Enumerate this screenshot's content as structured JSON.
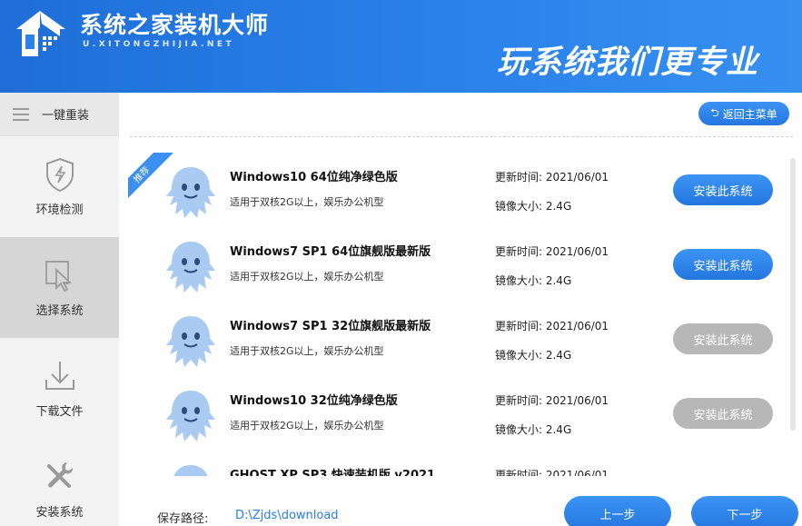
{
  "header": {
    "brand_title": "系统之家装机大师",
    "brand_sub": "U.XITONGZHIJIA.NET",
    "slogan": "玩系统我们更专业"
  },
  "sidebar": {
    "top_label": "一键重装",
    "items": [
      {
        "label": "环境检测",
        "icon": "shield-icon"
      },
      {
        "label": "选择系统",
        "icon": "cursor-icon"
      },
      {
        "label": "下载文件",
        "icon": "download-icon"
      },
      {
        "label": "安装系统",
        "icon": "tools-icon"
      }
    ]
  },
  "main": {
    "back_label": "返回主菜单",
    "ribbon": "推荐",
    "systems": [
      {
        "name": "Windows10 64位纯净绿色版",
        "desc": "适用于双核2G以上，娱乐办公机型",
        "update": "更新时间: 2021/06/01",
        "size": "镜像大小: 2.4G",
        "button": "安装此系统"
      },
      {
        "name": "Windows7 SP1 64位旗舰版最新版",
        "desc": "适用于双核2G以上，娱乐办公机型",
        "update": "更新时间: 2021/06/01",
        "size": "镜像大小: 2.4G",
        "button": "安装此系统"
      },
      {
        "name": "Windows7 SP1 32位旗舰版最新版",
        "desc": "适用于双核2G以上，娱乐办公机型",
        "update": "更新时间: 2021/06/01",
        "size": "镜像大小: 2.4G",
        "button": "安装此系统"
      },
      {
        "name": "Windows10 32位纯净绿色版",
        "desc": "适用于双核2G以上，娱乐办公机型",
        "update": "更新时间: 2021/06/01",
        "size": "镜像大小: 2.4G",
        "button": "安装此系统"
      },
      {
        "name": "GHOST XP SP3 快速装机版 v2021",
        "desc": "",
        "update": "更新时间: 2021/06/01",
        "size": "",
        "button": ""
      }
    ],
    "save_path_label": "保存路径:",
    "save_path": "D:\\Zjds\\download",
    "prev_label": "上一步",
    "next_label": "下一步"
  },
  "colors": {
    "accent": "#2b83ea",
    "disabled": "#b7b7b7",
    "ghost": "#a9cbf2"
  }
}
